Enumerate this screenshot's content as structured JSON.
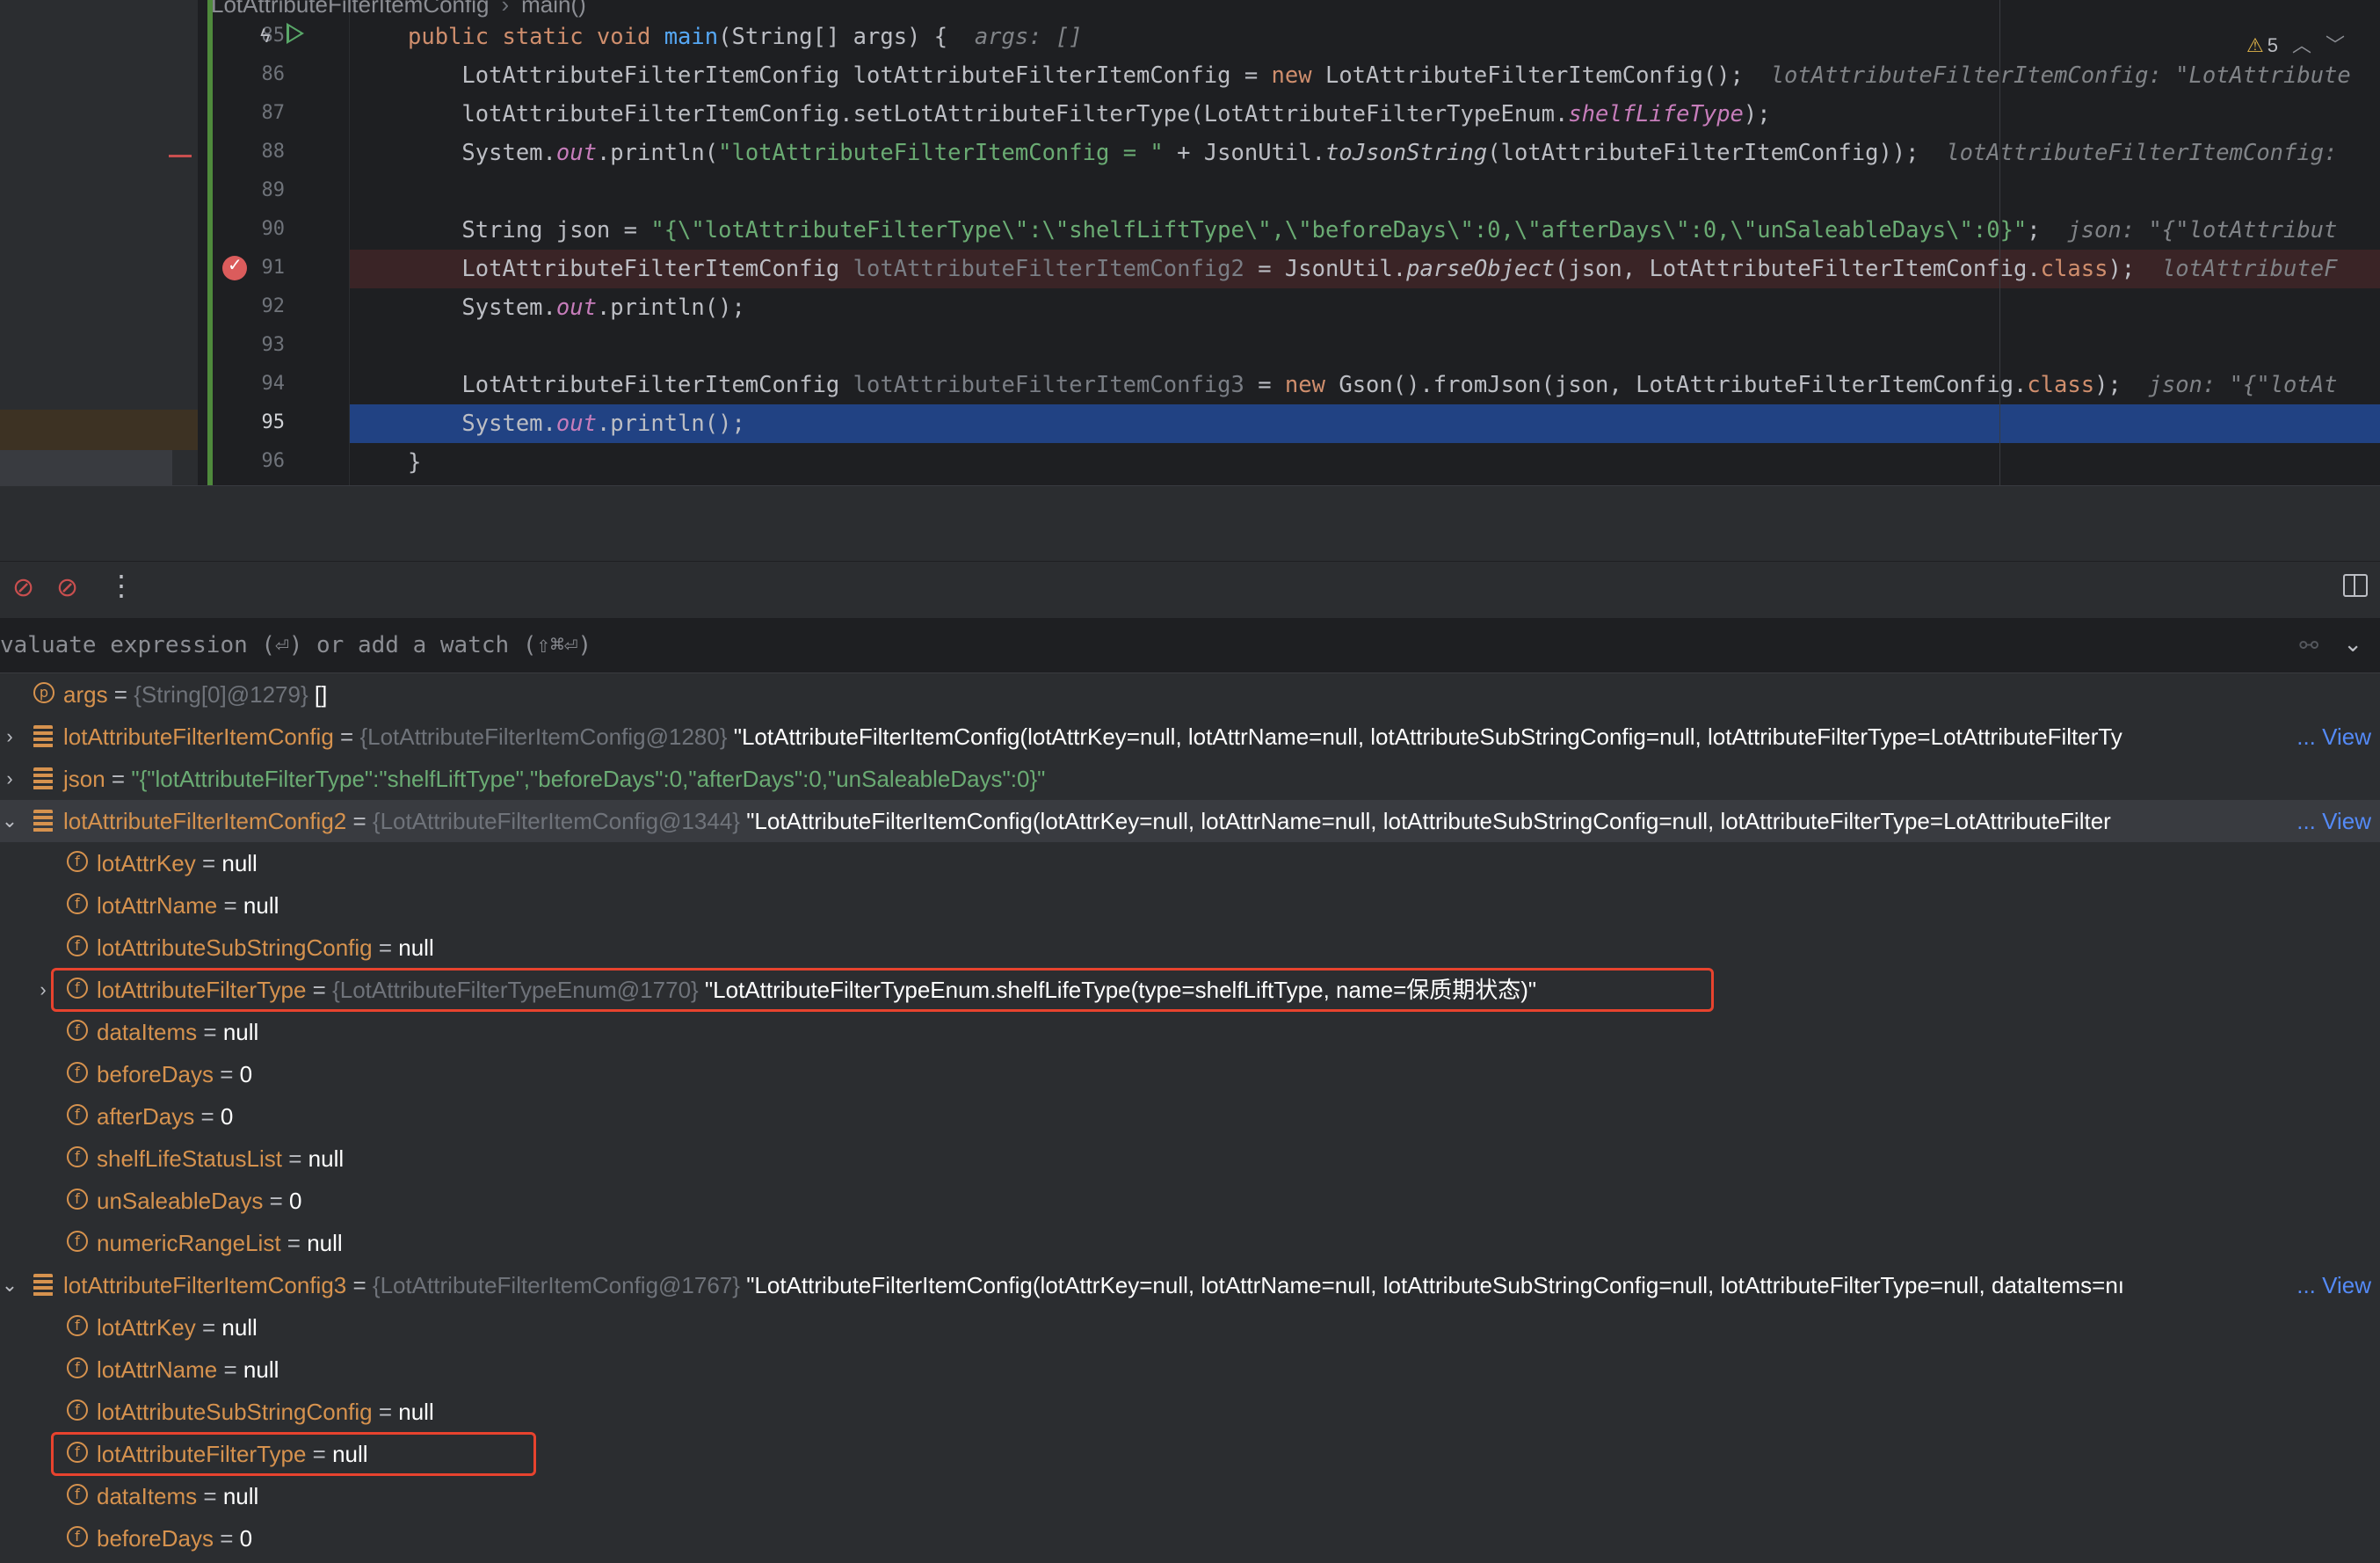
{
  "breadcrumb": {
    "class_name": "LotAttributeFilterItemConfig",
    "method": "main()"
  },
  "editor": {
    "warnings_count": "5",
    "lines": [
      {
        "n": "85",
        "parts": [
          [
            "kw",
            "public static void "
          ],
          [
            "fn",
            "main"
          ],
          [
            "",
            "(String[] args) {  "
          ],
          [
            "hint",
            "args: []"
          ]
        ]
      },
      {
        "n": "86",
        "parts": [
          [
            "",
            "    LotAttributeFilterItemConfig lotAttributeFilterItemConfig = "
          ],
          [
            "kw",
            "new "
          ],
          [
            "",
            "LotAttributeFilterItemConfig();  "
          ],
          [
            "hint",
            "lotAttributeFilterItemConfig: \"LotAttribute"
          ]
        ]
      },
      {
        "n": "87",
        "parts": [
          [
            "",
            "    lotAttributeFilterItemConfig.setLotAttributeFilterType(LotAttributeFilterTypeEnum."
          ],
          [
            "it",
            "shelfLifeType"
          ],
          [
            "",
            "); "
          ]
        ]
      },
      {
        "n": "88",
        "parts": [
          [
            "",
            "    System."
          ],
          [
            "it",
            "out"
          ],
          [
            "",
            ".println("
          ],
          [
            "str",
            "\"lotAttributeFilterItemConfig = \""
          ],
          [
            "",
            " + JsonUtil."
          ],
          [
            "sti",
            "toJsonString"
          ],
          [
            "",
            "(lotAttributeFilterItemConfig));  "
          ],
          [
            "hint",
            "lotAttributeFilterItemConfig:"
          ]
        ]
      },
      {
        "n": "89",
        "parts": []
      },
      {
        "n": "90",
        "parts": [
          [
            "",
            "    String json = "
          ],
          [
            "str",
            "\"{\\\"lotAttributeFilterType\\\":\\\"shelfLiftType\\\",\\\"beforeDays\\\":0,\\\"afterDays\\\":0,\\\"unSaleableDays\\\":0}\""
          ],
          [
            "",
            ";  "
          ],
          [
            "hint",
            "json: \"{\"lotAttribut"
          ]
        ]
      },
      {
        "n": "91",
        "parts": [
          [
            "",
            "    LotAttributeFilterItemConfig "
          ],
          [
            "grey",
            "lotAttributeFilterItemConfig2"
          ],
          [
            "",
            " = JsonUtil."
          ],
          [
            "sti",
            "parseObject"
          ],
          [
            "",
            "(json, LotAttributeFilterItemConfig."
          ],
          [
            "kw",
            "class"
          ],
          [
            "",
            ");  "
          ],
          [
            "hint",
            "lotAttributeF"
          ]
        ]
      },
      {
        "n": "92",
        "parts": [
          [
            "",
            "    System."
          ],
          [
            "it",
            "out"
          ],
          [
            "",
            ".println();"
          ]
        ]
      },
      {
        "n": "93",
        "parts": []
      },
      {
        "n": "94",
        "parts": [
          [
            "",
            "    LotAttributeFilterItemConfig "
          ],
          [
            "grey",
            "lotAttributeFilterItemConfig3"
          ],
          [
            "",
            " = "
          ],
          [
            "kw",
            "new "
          ],
          [
            "",
            "Gson().fromJson(json, LotAttributeFilterItemConfig."
          ],
          [
            "kw",
            "class"
          ],
          [
            "",
            ");  "
          ],
          [
            "hint",
            "json: \"{\"lotAt"
          ]
        ]
      },
      {
        "n": "95",
        "parts": [
          [
            "",
            "    System."
          ],
          [
            "it",
            "out"
          ],
          [
            "",
            ".println();"
          ]
        ]
      },
      {
        "n": "96",
        "parts": [
          [
            "",
            "}"
          ]
        ]
      }
    ]
  },
  "watch": {
    "placeholder": "valuate expression (⏎) or add a watch (⇧⌘⏎)"
  },
  "variables": [
    {
      "level": 0,
      "toggle": "",
      "icon": "p",
      "name": "args",
      "type": "{String[0]@1279}",
      "value": "[]",
      "vclass": "vval"
    },
    {
      "level": 0,
      "toggle": "›",
      "icon": "obj",
      "name": "lotAttributeFilterItemConfig",
      "type": "{LotAttributeFilterItemConfig@1280}",
      "value": "\"LotAttributeFilterItemConfig(lotAttrKey=null, lotAttrName=null, lotAttributeSubStringConfig=null, lotAttributeFilterType=LotAttributeFilterTy",
      "vclass": "vval",
      "link": "... View"
    },
    {
      "level": 0,
      "toggle": "›",
      "icon": "obj",
      "name": "json",
      "type": "",
      "value": "\"{\"lotAttributeFilterType\":\"shelfLiftType\",\"beforeDays\":0,\"afterDays\":0,\"unSaleableDays\":0}\"",
      "vclass": "vstr"
    },
    {
      "level": 0,
      "toggle": "⌄",
      "icon": "obj",
      "name": "lotAttributeFilterItemConfig2",
      "type": "{LotAttributeFilterItemConfig@1344}",
      "value": "\"LotAttributeFilterItemConfig(lotAttrKey=null, lotAttrName=null, lotAttributeSubStringConfig=null, lotAttributeFilterType=LotAttributeFilter",
      "vclass": "vval",
      "link": "... View",
      "hl": true
    },
    {
      "level": 1,
      "toggle": "",
      "icon": "f",
      "name": "lotAttrKey",
      "type": "",
      "value": "null",
      "vclass": "vval"
    },
    {
      "level": 1,
      "toggle": "",
      "icon": "f",
      "name": "lotAttrName",
      "type": "",
      "value": "null",
      "vclass": "vval"
    },
    {
      "level": 1,
      "toggle": "",
      "icon": "f",
      "name": "lotAttributeSubStringConfig",
      "type": "",
      "value": "null",
      "vclass": "vval"
    },
    {
      "level": 1,
      "toggle": "›",
      "icon": "f",
      "name": "lotAttributeFilterType",
      "type": "{LotAttributeFilterTypeEnum@1770}",
      "value": "\"LotAttributeFilterTypeEnum.shelfLifeType(type=shelfLiftType, name=保质期状态)\"",
      "vclass": "vval",
      "box": true
    },
    {
      "level": 1,
      "toggle": "",
      "icon": "f",
      "name": "dataItems",
      "type": "",
      "value": "null",
      "vclass": "vval"
    },
    {
      "level": 1,
      "toggle": "",
      "icon": "f",
      "name": "beforeDays",
      "type": "",
      "value": "0",
      "vclass": "vval"
    },
    {
      "level": 1,
      "toggle": "",
      "icon": "f",
      "name": "afterDays",
      "type": "",
      "value": "0",
      "vclass": "vval"
    },
    {
      "level": 1,
      "toggle": "",
      "icon": "f",
      "name": "shelfLifeStatusList",
      "type": "",
      "value": "null",
      "vclass": "vval"
    },
    {
      "level": 1,
      "toggle": "",
      "icon": "f",
      "name": "unSaleableDays",
      "type": "",
      "value": "0",
      "vclass": "vval"
    },
    {
      "level": 1,
      "toggle": "",
      "icon": "f",
      "name": "numericRangeList",
      "type": "",
      "value": "null",
      "vclass": "vval"
    },
    {
      "level": 0,
      "toggle": "⌄",
      "icon": "obj",
      "name": "lotAttributeFilterItemConfig3",
      "type": "{LotAttributeFilterItemConfig@1767}",
      "value": "\"LotAttributeFilterItemConfig(lotAttrKey=null, lotAttrName=null, lotAttributeSubStringConfig=null, lotAttributeFilterType=null, dataItems=nı",
      "vclass": "vval",
      "link": "... View"
    },
    {
      "level": 1,
      "toggle": "",
      "icon": "f",
      "name": "lotAttrKey",
      "type": "",
      "value": "null",
      "vclass": "vval"
    },
    {
      "level": 1,
      "toggle": "",
      "icon": "f",
      "name": "lotAttrName",
      "type": "",
      "value": "null",
      "vclass": "vval"
    },
    {
      "level": 1,
      "toggle": "",
      "icon": "f",
      "name": "lotAttributeSubStringConfig",
      "type": "",
      "value": "null",
      "vclass": "vval"
    },
    {
      "level": 1,
      "toggle": "",
      "icon": "f",
      "name": "lotAttributeFilterType",
      "type": "",
      "value": "null",
      "vclass": "vval",
      "box": true
    },
    {
      "level": 1,
      "toggle": "",
      "icon": "f",
      "name": "dataItems",
      "type": "",
      "value": "null",
      "vclass": "vval"
    },
    {
      "level": 1,
      "toggle": "",
      "icon": "f",
      "name": "beforeDays",
      "type": "",
      "value": "0",
      "vclass": "vval"
    }
  ],
  "colors": {
    "accent_link": "#548af7",
    "highlight_box": "#e8432e",
    "selected_line": "#214283"
  }
}
